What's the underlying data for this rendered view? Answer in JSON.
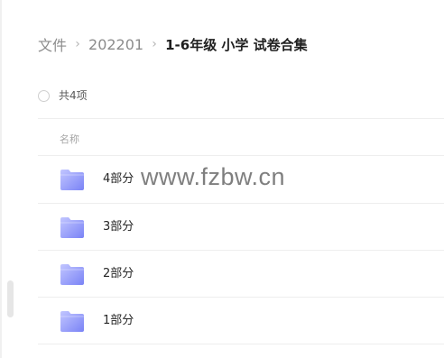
{
  "breadcrumb": {
    "items": [
      {
        "label": "文件"
      },
      {
        "label": "202201"
      }
    ],
    "current": "1-6年级 小学 试卷合集",
    "separator": "›"
  },
  "selection": {
    "count_text": "共4项"
  },
  "table": {
    "column_name": "名称"
  },
  "files": [
    {
      "name": "4部分",
      "icon": "folder-icon"
    },
    {
      "name": "3部分",
      "icon": "folder-icon"
    },
    {
      "name": "2部分",
      "icon": "folder-icon"
    },
    {
      "name": "1部分",
      "icon": "folder-icon"
    }
  ],
  "watermark": "www.fzbw.cn",
  "colors": {
    "folder_light": "#b3b8ff",
    "folder_dark": "#7a83f6"
  }
}
